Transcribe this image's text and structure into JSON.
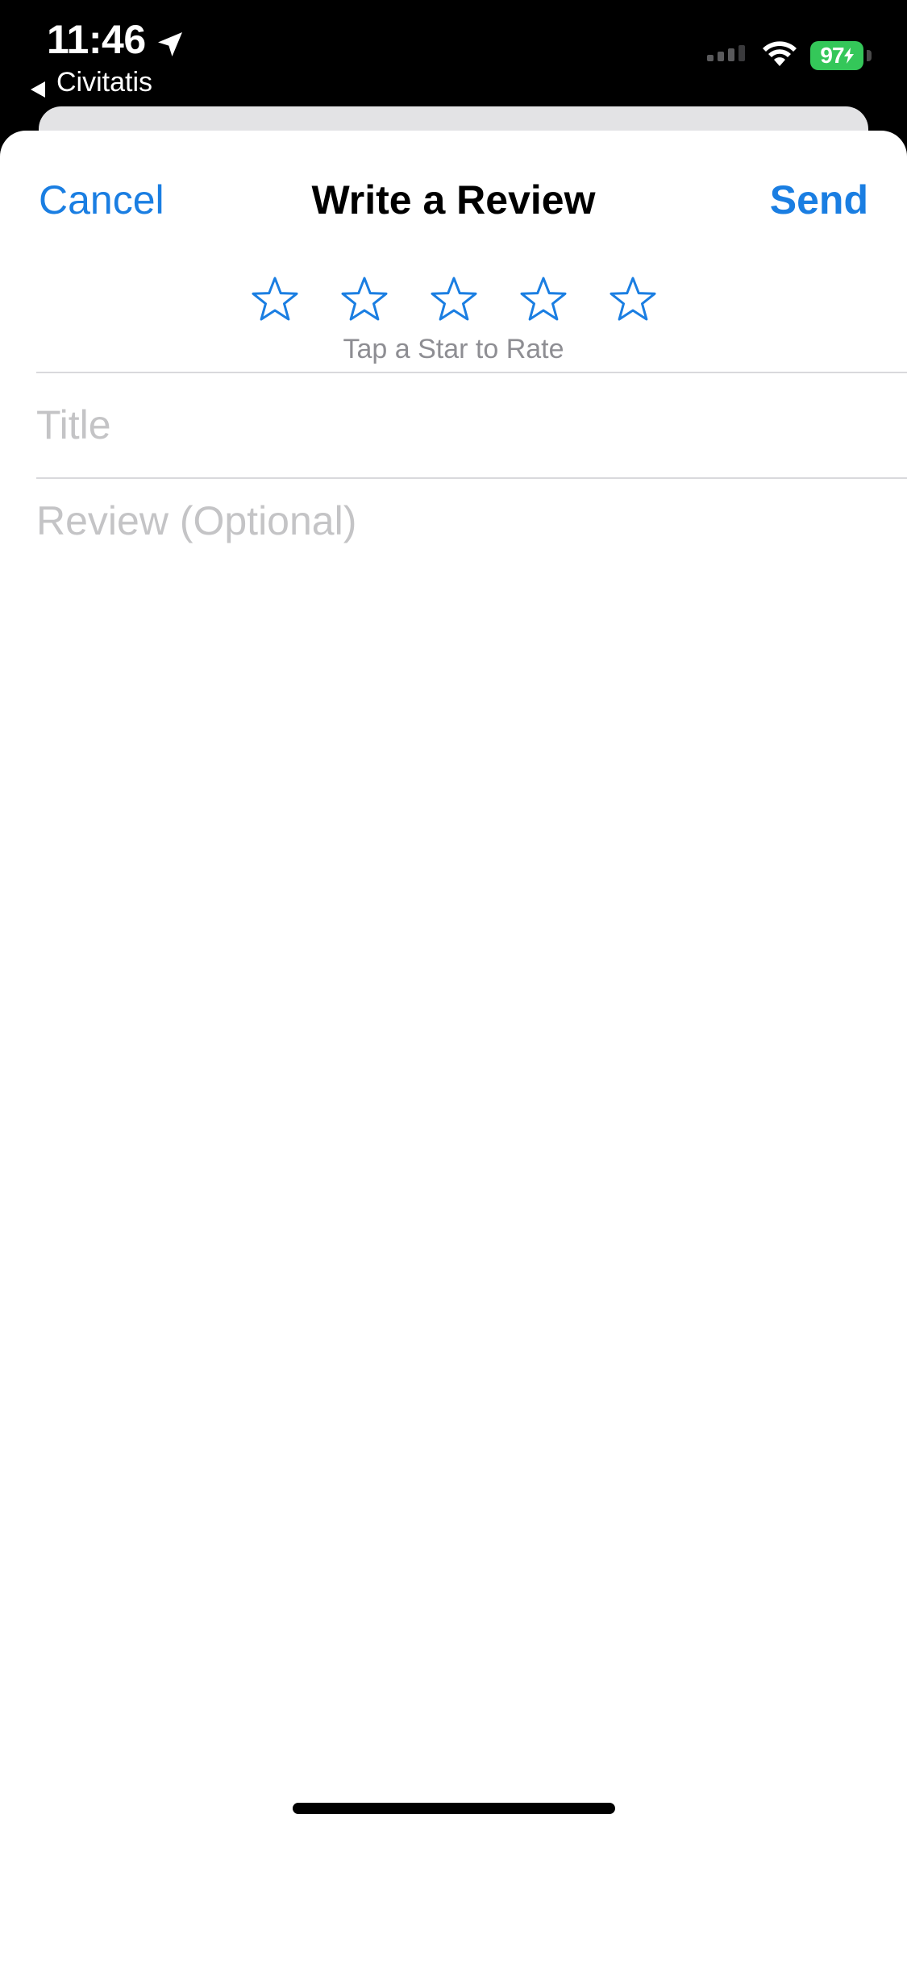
{
  "status_bar": {
    "time": "11:46",
    "back_app": "Civitatis",
    "battery": "97",
    "icons": {
      "location": "location-arrow-icon",
      "signal": "signal-icon",
      "wifi": "wifi-icon",
      "charging": "bolt-icon"
    }
  },
  "nav": {
    "cancel_label": "Cancel",
    "title": "Write a Review",
    "send_label": "Send"
  },
  "rating": {
    "stars": [
      1,
      2,
      3,
      4,
      5
    ],
    "hint": "Tap a Star to Rate"
  },
  "form": {
    "title_placeholder": "Title",
    "review_placeholder": "Review (Optional)"
  },
  "colors": {
    "accent": "#1a7ee2",
    "battery": "#34c759",
    "placeholder": "#c4c4c6",
    "hint": "#8e8e93"
  }
}
